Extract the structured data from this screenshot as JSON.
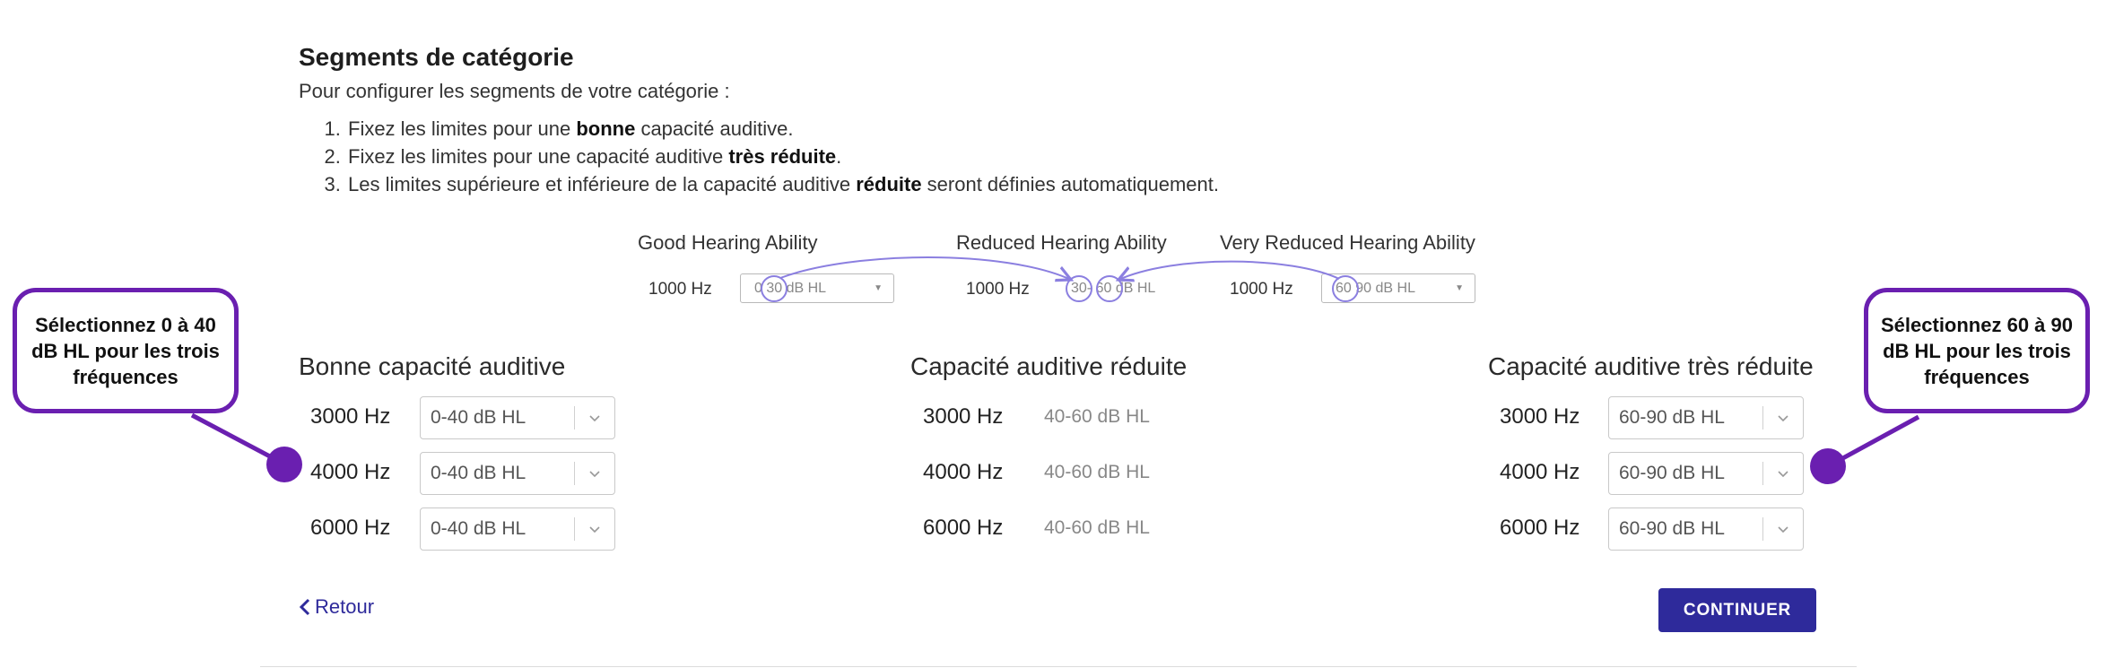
{
  "heading": {
    "title": "Segments de catégorie",
    "intro": "Pour configurer les segments de votre catégorie :"
  },
  "steps": [
    {
      "before": "Fixez les limites pour une ",
      "bold": "bonne",
      "after": " capacité auditive."
    },
    {
      "before": "Fixez les limites pour une capacité auditive ",
      "bold": "très réduite",
      "after": "."
    },
    {
      "before": "Les limites supérieure et inférieure de la capacité auditive ",
      "bold": "réduite",
      "after": " seront définies automatiquement."
    }
  ],
  "example": {
    "good": {
      "heading": "Good Hearing Ability",
      "freq": "1000 Hz",
      "low": "0",
      "high": "30",
      "unit": "dB HL"
    },
    "reduced": {
      "heading": "Reduced Hearing Ability",
      "freq": "1000 Hz",
      "low": "30",
      "dash": "-",
      "high": "60",
      "unit": "dB HL"
    },
    "very_reduced": {
      "heading": "Very Reduced Hearing Ability",
      "freq": "1000 Hz",
      "low": "60",
      "high": "90 dB HL"
    }
  },
  "groups": {
    "good": {
      "heading": "Bonne capacité auditive",
      "rows": [
        {
          "freq": "3000 Hz",
          "value": "0-40 dB HL"
        },
        {
          "freq": "4000 Hz",
          "value": "0-40 dB HL"
        },
        {
          "freq": "6000 Hz",
          "value": "0-40 dB HL"
        }
      ]
    },
    "reduced": {
      "heading": "Capacité auditive réduite",
      "rows": [
        {
          "freq": "3000 Hz",
          "value": "40-60 dB HL"
        },
        {
          "freq": "4000 Hz",
          "value": "40-60 dB HL"
        },
        {
          "freq": "6000 Hz",
          "value": "40-60 dB HL"
        }
      ]
    },
    "very_reduced": {
      "heading": "Capacité auditive très réduite",
      "rows": [
        {
          "freq": "3000 Hz",
          "value": "60-90 dB HL"
        },
        {
          "freq": "4000 Hz",
          "value": "60-90 dB HL"
        },
        {
          "freq": "6000 Hz",
          "value": "60-90 dB HL"
        }
      ]
    }
  },
  "nav": {
    "back_label": "Retour",
    "continue_label": "CONTINUER"
  },
  "callouts": {
    "left": "Sélectionnez 0 à 40 dB HL pour les trois fréquences",
    "right": "Sélectionnez 60 à 90 dB HL pour les trois fréquences"
  },
  "colors": {
    "accent": "#2e2a9b",
    "callout": "#6a1fb0",
    "diagram_arrow": "#8b7fe0"
  },
  "icons": {
    "back": "chevron-left-icon",
    "select": "chevron-down-icon",
    "example_select": "caret-down-icon"
  }
}
